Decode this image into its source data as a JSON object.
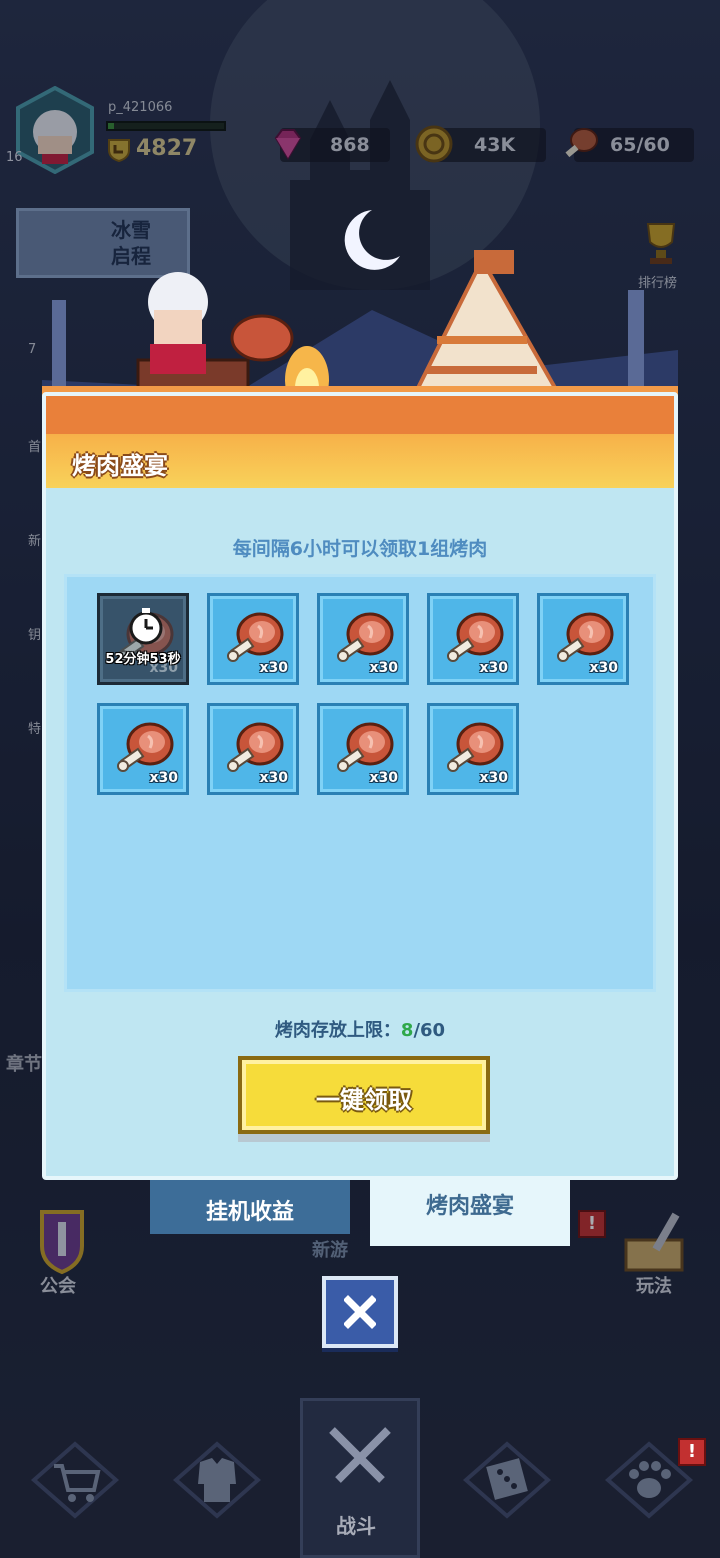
{
  "player": {
    "name": "p_421066",
    "level": "16",
    "power": "4827",
    "xp_fraction": 0.05
  },
  "resources": {
    "gems": "868",
    "gold": "43K",
    "meat": "65/60"
  },
  "side_menu": {
    "event_banner": "冰雪\n启程",
    "ranking_label": "排行榜",
    "items": [
      "7",
      "首",
      "新",
      "钥",
      "特"
    ]
  },
  "panel": {
    "title": "烤肉盛宴",
    "subtitle": "每间隔6小时可以领取1组烤肉",
    "slots": [
      {
        "qty": "x30",
        "locked": true,
        "timer": "52分钟53秒"
      },
      {
        "qty": "x30",
        "locked": false
      },
      {
        "qty": "x30",
        "locked": false
      },
      {
        "qty": "x30",
        "locked": false
      },
      {
        "qty": "x30",
        "locked": false
      },
      {
        "qty": "x30",
        "locked": false
      },
      {
        "qty": "x30",
        "locked": false
      },
      {
        "qty": "x30",
        "locked": false
      },
      {
        "qty": "x30",
        "locked": false
      }
    ],
    "storage_label": "烤肉存放上限：",
    "storage_current": "8",
    "storage_max": "/60",
    "claim_button": "一键领取"
  },
  "tabs": {
    "idle_income": "挂机收益",
    "meat_feast": "烤肉盛宴"
  },
  "background": {
    "guild_label": "公会",
    "play_label": "玩法",
    "chapter_label": "章节",
    "newbie_label": "新游",
    "alert_mark": "!"
  },
  "bottom_nav": {
    "battle_label": "战斗"
  },
  "colors": {
    "panel_bg": "#bfe6f2",
    "grid_bg": "#9ed8f4",
    "slot_bg": "#4fb6e8",
    "claim_button": "#f6dc3a",
    "close_button": "#3a5ca8",
    "storage_current": "#2fa84a"
  }
}
